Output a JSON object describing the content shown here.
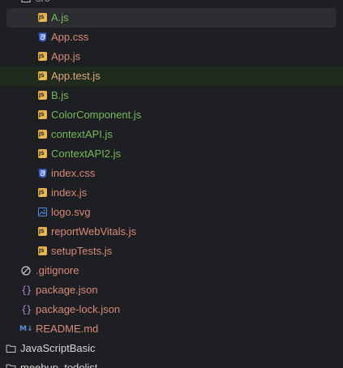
{
  "tree": {
    "parent_folder": "src",
    "src_files": [
      {
        "name": "A.js",
        "icon": "js-icon",
        "color": "green",
        "state": "selected"
      },
      {
        "name": "App.css",
        "icon": "css-icon",
        "color": "red",
        "state": ""
      },
      {
        "name": "App.js",
        "icon": "js-icon",
        "color": "red",
        "state": ""
      },
      {
        "name": "App.test.js",
        "icon": "js-test-icon",
        "color": "orange",
        "state": "hover"
      },
      {
        "name": "B.js",
        "icon": "js-icon",
        "color": "green",
        "state": ""
      },
      {
        "name": "ColorComponent.js",
        "icon": "js-icon",
        "color": "green",
        "state": ""
      },
      {
        "name": "contextAPI.js",
        "icon": "js-icon",
        "color": "green",
        "state": ""
      },
      {
        "name": "ContextAPI2.js",
        "icon": "js-icon",
        "color": "green",
        "state": ""
      },
      {
        "name": "index.css",
        "icon": "css-icon",
        "color": "red",
        "state": ""
      },
      {
        "name": "index.js",
        "icon": "js-icon",
        "color": "red",
        "state": ""
      },
      {
        "name": "logo.svg",
        "icon": "svg-image-icon",
        "color": "red",
        "state": ""
      },
      {
        "name": "reportWebVitals.js",
        "icon": "js-icon",
        "color": "red",
        "state": ""
      },
      {
        "name": "setupTests.js",
        "icon": "js-icon",
        "color": "red",
        "state": ""
      }
    ],
    "root_files": [
      {
        "name": ".gitignore",
        "icon": "gitignore-icon",
        "color": "red"
      },
      {
        "name": "package.json",
        "icon": "json-braces-icon",
        "color": "red"
      },
      {
        "name": "package-lock.json",
        "icon": "json-braces-icon",
        "color": "red"
      },
      {
        "name": "README.md",
        "icon": "markdown-icon",
        "color": "red"
      }
    ],
    "folders": [
      {
        "name": "JavaScriptBasic"
      },
      {
        "name": "meebup_todolist"
      }
    ],
    "js_badge_text": "JS",
    "md_badge_text": "M↓"
  }
}
